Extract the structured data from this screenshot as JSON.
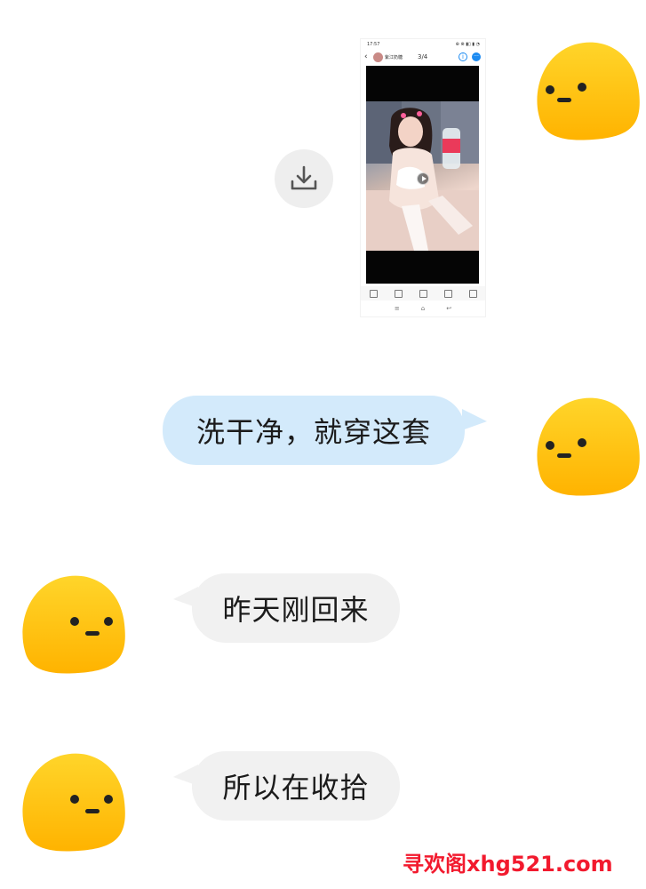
{
  "colors": {
    "sent_bubble": "#d3eafb",
    "received_bubble": "#f1f1f1",
    "avatar_top": "#ffd52a",
    "avatar_bottom": "#ffb300",
    "watermark": "#f21a2e",
    "accent_blue": "#1d8bf1"
  },
  "messages": [
    {
      "direction": "sent",
      "type": "image",
      "avatar_icon": "yellow-blob-avatar",
      "download_icon": "download-icon",
      "screenshot": {
        "status_time": "17:57",
        "status_icons": "⊕ ⊗ ▮▯ ▮ ◔",
        "contact_name": "紫江奶糖",
        "counter": "3/4",
        "info_icon": "info-icon",
        "more_icon": "more-icon",
        "media_icon": "play-icon",
        "toolbar_icons": [
          "edit-icon",
          "share-icon",
          "download-icon",
          "note-icon",
          "like-icon"
        ],
        "nav_icons": [
          "≡",
          "⌂",
          "↩"
        ]
      }
    },
    {
      "direction": "sent",
      "type": "text",
      "text": "洗干净，就穿这套",
      "avatar_icon": "yellow-blob-avatar"
    },
    {
      "direction": "received",
      "type": "text",
      "text": "昨天刚回来",
      "avatar_icon": "yellow-blob-avatar"
    },
    {
      "direction": "received",
      "type": "text",
      "text": "所以在收拾",
      "avatar_icon": "yellow-blob-avatar"
    }
  ],
  "watermark": "寻欢阁xhg521.com"
}
